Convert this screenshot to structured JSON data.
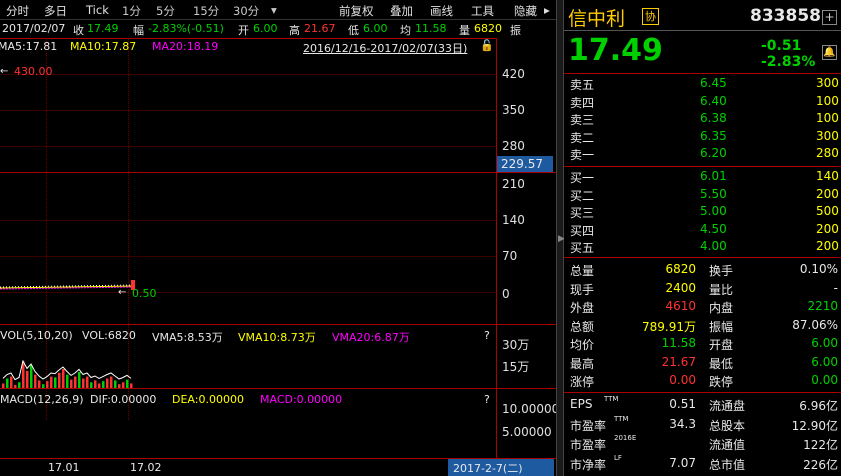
{
  "toolbar": {
    "items": [
      "分时",
      "多日",
      "Tick",
      "1分",
      "5分",
      "15分",
      "30分",
      "▾",
      "前复权",
      "叠加",
      "画线",
      "工具",
      "隐藏",
      "▸"
    ]
  },
  "info": {
    "date": "2017/02/07",
    "close_label": "收",
    "close": "17.49",
    "change_label": "幅",
    "change": "-2.83%(-0.51)",
    "open_label": "开",
    "open": "6.00",
    "high_label": "高",
    "high": "21.67",
    "low_label": "低",
    "low": "6.00",
    "avg_label": "均",
    "avg": "11.58",
    "vol_label": "量",
    "vol": "6820",
    "swing_label": "振"
  },
  "ma": {
    "ma5": "MA5:17.81",
    "ma10": "MA10:17.87",
    "ma20": "MA20:18.19",
    "range": "2016/12/16-2017/02/07(33日)"
  },
  "price_axis": [
    "420",
    "350",
    "280",
    "229.57",
    "210",
    "140",
    "70",
    "0"
  ],
  "price_marks": {
    "high_mark": "430.00",
    "low_mark": "0.50"
  },
  "volume": {
    "label": "VOL(5,10,20)",
    "vol": "VOL:6820",
    "vma5": "VMA5:8.53万",
    "vma10": "VMA10:8.73万",
    "vma20": "VMA20:6.87万",
    "axis": [
      "30万",
      "15万"
    ],
    "help": "?",
    "bars": [
      0.12,
      0.25,
      0.3,
      0.08,
      0.15,
      0.7,
      0.45,
      0.6,
      0.35,
      0.2,
      0.1,
      0.18,
      0.3,
      0.28,
      0.4,
      0.5,
      0.35,
      0.22,
      0.3,
      0.42,
      0.25,
      0.3,
      0.15,
      0.2,
      0.12,
      0.18,
      0.25,
      0.3,
      0.2,
      0.1,
      0.15,
      0.22,
      0.12
    ]
  },
  "macd": {
    "label": "MACD(12,26,9)",
    "dif": "DIF:0.00000",
    "dea": "DEA:0.00000",
    "macd": "MACD:0.00000",
    "axis": [
      "10.00000",
      "5.00000"
    ],
    "help": "?"
  },
  "xaxis": {
    "labels": [
      "17.01",
      "17.02"
    ],
    "cursor_date": "2017-2-7(二)"
  },
  "quote": {
    "name": "信中利",
    "badge": "协",
    "code": "833858",
    "price": "17.49",
    "change": "-0.51",
    "change_pct": "-2.83%",
    "asks": [
      {
        "label": "卖五",
        "price": "6.45",
        "vol": "300"
      },
      {
        "label": "卖四",
        "price": "6.40",
        "vol": "100"
      },
      {
        "label": "卖三",
        "price": "6.38",
        "vol": "100"
      },
      {
        "label": "卖二",
        "price": "6.35",
        "vol": "300"
      },
      {
        "label": "卖一",
        "price": "6.20",
        "vol": "280"
      }
    ],
    "bids": [
      {
        "label": "买一",
        "price": "6.01",
        "vol": "140"
      },
      {
        "label": "买二",
        "price": "5.50",
        "vol": "200"
      },
      {
        "label": "买三",
        "price": "5.00",
        "vol": "500"
      },
      {
        "label": "买四",
        "price": "4.50",
        "vol": "200"
      },
      {
        "label": "买五",
        "price": "4.00",
        "vol": "200"
      }
    ],
    "stats": [
      {
        "l1": "总量",
        "v1": "6820",
        "c1": "yellow",
        "l2": "换手",
        "v2": "0.10%",
        "c2": "white"
      },
      {
        "l1": "现手",
        "v1": "2400",
        "c1": "yellow",
        "l2": "量比",
        "v2": "-",
        "c2": "white"
      },
      {
        "l1": "外盘",
        "v1": "4610",
        "c1": "red",
        "l2": "内盘",
        "v2": "2210",
        "c2": "green"
      },
      {
        "l1": "总额",
        "v1": "789.91万",
        "c1": "yellow",
        "l2": "振幅",
        "v2": "87.06%",
        "c2": "white"
      },
      {
        "l1": "均价",
        "v1": "11.58",
        "c1": "green",
        "l2": "开盘",
        "v2": "6.00",
        "c2": "green"
      },
      {
        "l1": "最高",
        "v1": "21.67",
        "c1": "red",
        "l2": "最低",
        "v2": "6.00",
        "c2": "green"
      },
      {
        "l1": "涨停",
        "v1": "0.00",
        "c1": "red",
        "l2": "跌停",
        "v2": "0.00",
        "c2": "green"
      }
    ],
    "fund": [
      {
        "l1": "EPS",
        "sup1": "TTM",
        "v1": "0.51",
        "l2": "流通盘",
        "v2": "6.96亿"
      },
      {
        "l1": "市盈率",
        "sup1": "TTM",
        "v1": "34.3",
        "l2": "总股本",
        "v2": "12.90亿"
      },
      {
        "l1": "市盈率",
        "sup1": "2016E",
        "v1": "",
        "l2": "流通值",
        "v2": "122亿"
      },
      {
        "l1": "市净率",
        "sup1": "LF",
        "v1": "7.07",
        "l2": "总市值",
        "v2": "226亿"
      }
    ]
  },
  "colors": {
    "up": "#ff3232",
    "down": "#00d000",
    "grid": "#a00000",
    "accent": "#ff8c00"
  }
}
